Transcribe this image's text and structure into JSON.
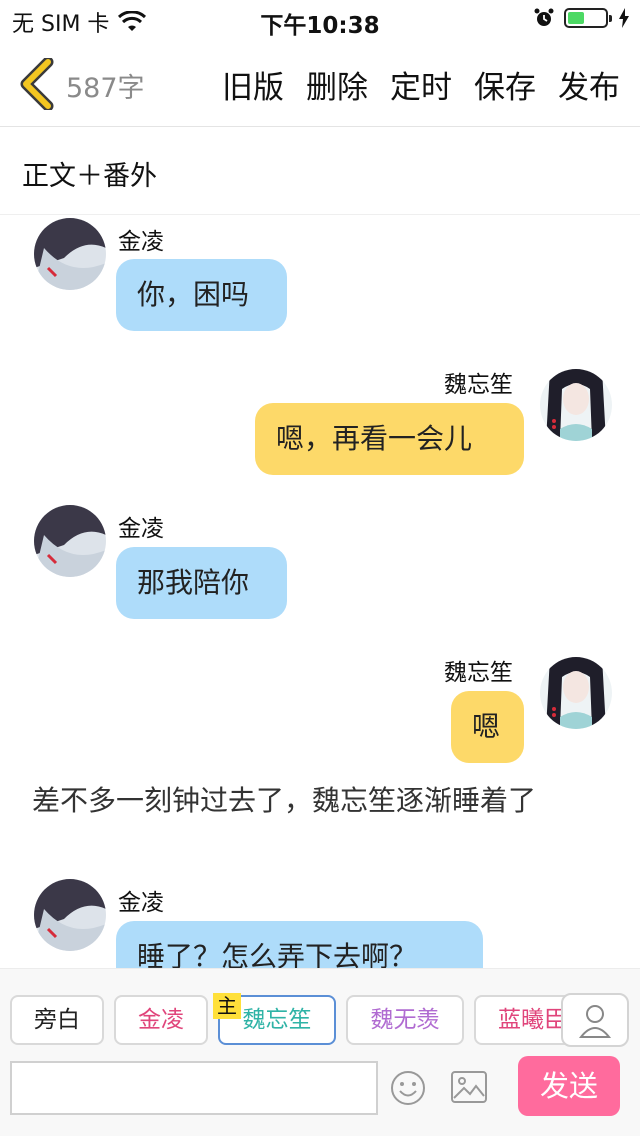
{
  "status_bar": {
    "carrier": "无 SIM 卡",
    "time": "下午10:38",
    "battery_level": 0.45
  },
  "nav": {
    "word_count": "587字",
    "actions": [
      {
        "label": "旧版"
      },
      {
        "label": "删除"
      },
      {
        "label": "定时"
      },
      {
        "label": "保存"
      },
      {
        "label": "发布"
      }
    ]
  },
  "chapter": {
    "title": "正文＋番外"
  },
  "messages": [
    {
      "speaker": "金凌",
      "text": "你，困吗",
      "side": "left"
    },
    {
      "speaker": "魏忘笙",
      "text": "嗯，再看一会儿",
      "side": "right"
    },
    {
      "speaker": "金凌",
      "text": "那我陪你",
      "side": "left"
    },
    {
      "speaker": "魏忘笙",
      "text": "嗯",
      "side": "right"
    },
    {
      "narration": "差不多一刻钟过去了，魏忘笙逐渐睡着了"
    },
    {
      "speaker": "金凌",
      "text": "睡了？怎么弄下去啊？",
      "side": "left"
    }
  ],
  "characters": [
    {
      "name": "旁白",
      "color": "#222222"
    },
    {
      "name": "金凌",
      "color": "#e0457b"
    },
    {
      "name": "魏忘笙",
      "color": "#2fb3a6",
      "is_main": true,
      "main_tag": "主"
    },
    {
      "name": "魏无羡",
      "color": "#b06bd1"
    },
    {
      "name": "蓝曦臣",
      "color": "#e0457b"
    }
  ],
  "input": {
    "value": "",
    "placeholder": "",
    "send_label": "发送"
  },
  "colors": {
    "left_bubble": "#aedcfa",
    "right_bubble": "#fdd969",
    "send_button": "#ff6b9d",
    "back_arrow": "#f3c621"
  }
}
